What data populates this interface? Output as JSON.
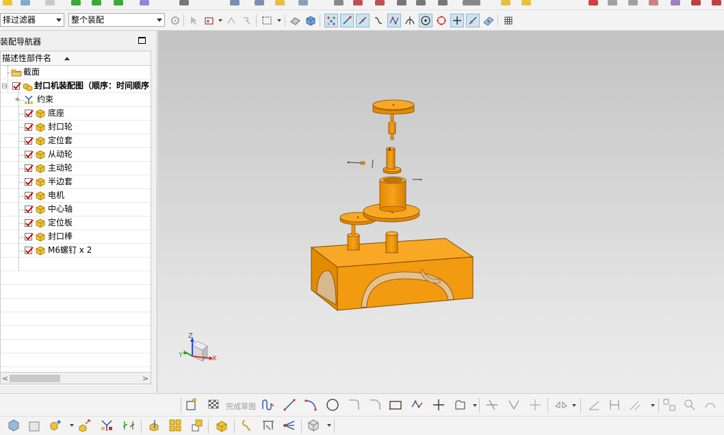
{
  "filters": {
    "selection_filter": "择过滤器",
    "scope": "整个装配"
  },
  "navigator": {
    "title": "装配导航器",
    "column_header": "描述性部件名",
    "items": [
      {
        "label": "截面",
        "type": "folder"
      },
      {
        "label": "封口机装配图（顺序：时间顺序",
        "type": "assembly",
        "checked": true
      },
      {
        "label": "约束",
        "type": "constraints"
      },
      {
        "label": "底座",
        "type": "part",
        "checked": true
      },
      {
        "label": "封口轮",
        "type": "part",
        "checked": true
      },
      {
        "label": "定位套",
        "type": "part",
        "checked": true
      },
      {
        "label": "从动轮",
        "type": "part",
        "checked": true
      },
      {
        "label": "主动轮",
        "type": "part",
        "checked": true
      },
      {
        "label": "半边套",
        "type": "part",
        "checked": true
      },
      {
        "label": "电机",
        "type": "part",
        "checked": true
      },
      {
        "label": "中心轴",
        "type": "part",
        "checked": true
      },
      {
        "label": "定位板",
        "type": "part",
        "checked": true
      },
      {
        "label": "封口棒",
        "type": "part",
        "checked": true
      },
      {
        "label": "M6螺钉 x 2",
        "type": "part",
        "checked": true
      }
    ]
  },
  "viewport": {
    "triad": {
      "x_label": "X",
      "y_label": "Y",
      "z_label": "Z"
    },
    "model_color": "#F5A623"
  },
  "sketch_toolbar": {
    "finish_sketch_label": "完成草图"
  },
  "colors": {
    "accent_active": "#cfe3ee",
    "check_red": "#d00000",
    "cube_yellow": "#f2c230"
  }
}
